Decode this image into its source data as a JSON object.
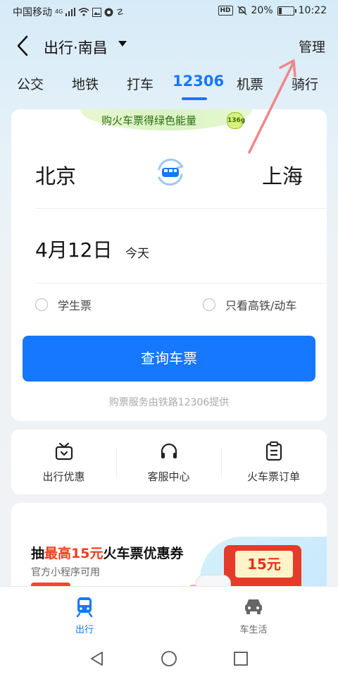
{
  "status_bar": {
    "carrier": "中国移动",
    "network": "4G",
    "hd": "HD",
    "battery": "20%",
    "time": "10:22"
  },
  "header": {
    "title": "出行·南昌",
    "manage_label": "管理"
  },
  "tabs": [
    {
      "label": "公交"
    },
    {
      "label": "地铁"
    },
    {
      "label": "打车"
    },
    {
      "label": "12306",
      "active": true
    },
    {
      "label": "机票"
    },
    {
      "label": "骑行"
    }
  ],
  "ticket_card": {
    "banner_text": "购火车票得绿色能量",
    "energy_badge": "136g",
    "from_city": "北京",
    "to_city": "上海",
    "date": "4月12日",
    "date_hint": "今天",
    "option_student": "学生票",
    "option_highspeed": "只看高铁/动车",
    "query_button": "查询车票",
    "provider_note": "购票服务由铁路12306提供"
  },
  "quick_actions": [
    {
      "label": "出行优惠",
      "icon": "gift-icon"
    },
    {
      "label": "客服中心",
      "icon": "headset-icon"
    },
    {
      "label": "火车票订单",
      "icon": "clipboard-icon"
    }
  ],
  "promo": {
    "title_prefix": "抽",
    "title_highlight": "最高15元",
    "title_suffix": "火车票优惠券",
    "subtitle": "官方小程序可用",
    "coupon_value": "15元"
  },
  "bottom_nav": [
    {
      "label": "出行",
      "active": true,
      "icon": "train-icon"
    },
    {
      "label": "车生活",
      "active": false,
      "icon": "car-icon"
    }
  ],
  "colors": {
    "accent": "#1677ff",
    "promo_highlight": "#f23d1d",
    "annotation_arrow": "#f0868a"
  }
}
